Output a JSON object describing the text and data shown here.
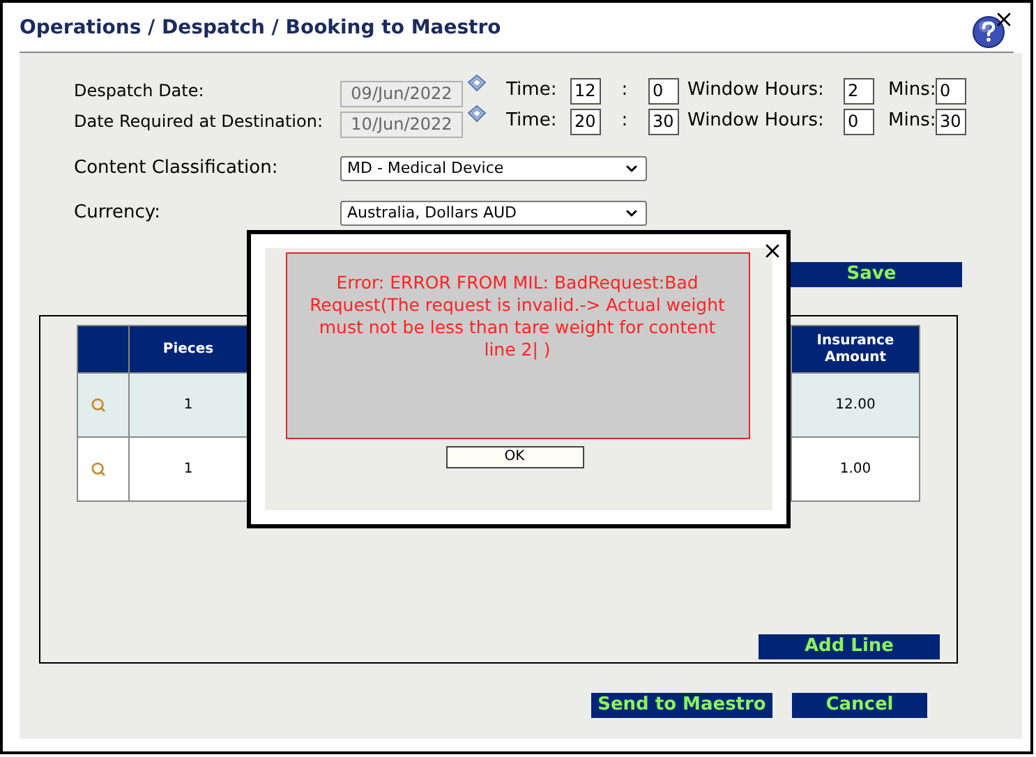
{
  "window": {
    "title": "Operations / Despatch / Booking to Maestro"
  },
  "schedule": [
    {
      "label": "Despatch Date:",
      "date": "09/Jun/2022",
      "time_label": "Time:",
      "hours": "12",
      "separator": ":",
      "minutes": "0",
      "window_label": "Window Hours:",
      "window_hours": "2",
      "mins_label": "Mins:",
      "window_mins": "0"
    },
    {
      "label": "Date Required at Destination:",
      "date": "10/Jun/2022",
      "time_label": "Time:",
      "hours": "20",
      "separator": ":",
      "minutes": "30",
      "window_label": "Window Hours:",
      "window_hours": "0",
      "mins_label": "Mins:",
      "window_mins": "30"
    }
  ],
  "selects": [
    {
      "label": "Content Classification:",
      "value": "MD - Medical Device"
    },
    {
      "label": "Currency:",
      "value": "Australia, Dollars AUD"
    }
  ],
  "save_button": "Save",
  "table": {
    "columns": [
      "Pieces",
      "Insurance Amount"
    ],
    "rows": [
      {
        "pieces": "1",
        "insurance_amount": "12.00"
      },
      {
        "pieces": "1",
        "insurance_amount": "1.00"
      }
    ]
  },
  "add_line_button": "Add Line",
  "buttons": [
    "Send to Maestro",
    "Cancel"
  ],
  "dialog": {
    "message": "Error: ERROR FROM MIL: BadRequest:Bad Request(The request is invalid.-> Actual weight must not be less than tare weight for content line 2| )",
    "ok_button": "OK"
  }
}
